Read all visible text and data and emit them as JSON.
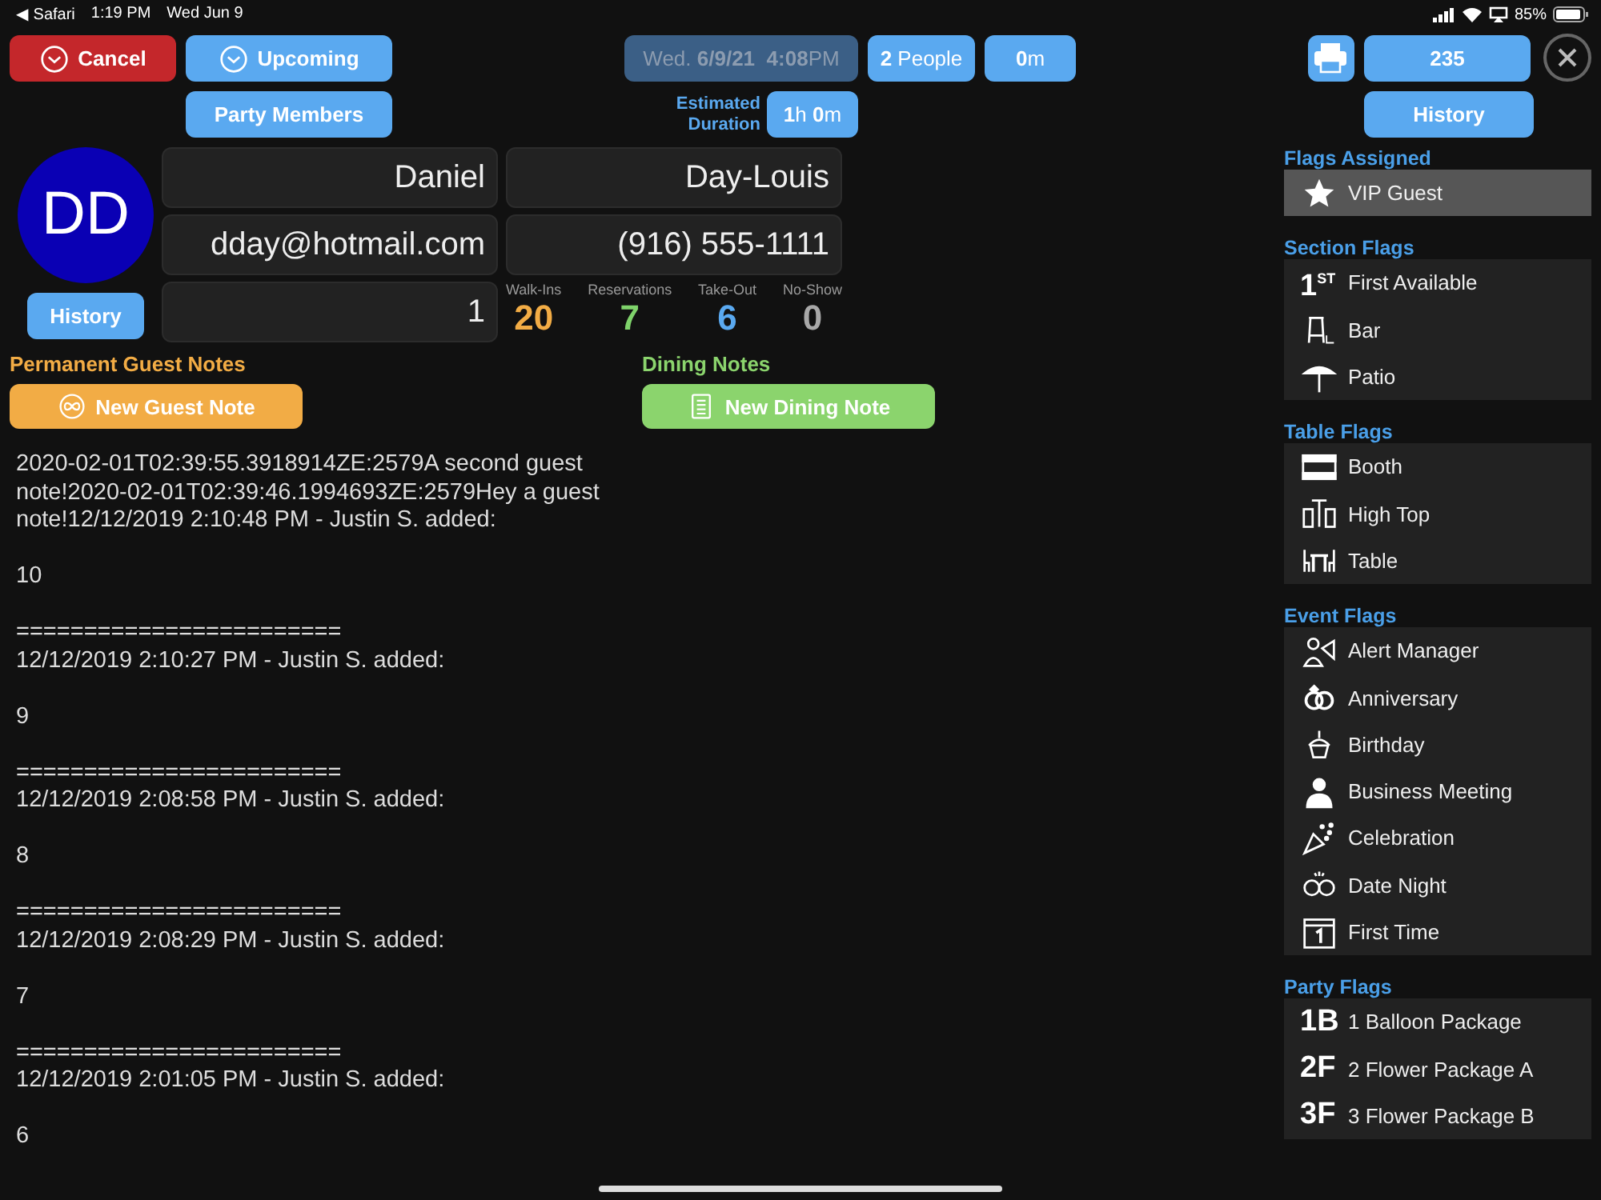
{
  "status_bar": {
    "back": "◀ Safari",
    "time": "1:19 PM",
    "date": "Wed Jun 9",
    "battery": "85%"
  },
  "toolbar": {
    "cancel": "Cancel",
    "upcoming": "Upcoming",
    "party_members": "Party Members",
    "datetime": "Wed. **6/9/21**  **4:08**PM",
    "people": "**2** People",
    "wait": "**0**m",
    "duration_label": "Estimated Duration",
    "duration": "**1**h **0**m"
  },
  "guest": {
    "initials": "DD",
    "history": "History",
    "first_name": "Daniel",
    "last_name": "Day-Louis",
    "email": "dday@hotmail.com",
    "phone": "(916) 555-1111",
    "field_5": "1"
  },
  "stats": [
    {
      "label": "Walk-Ins",
      "value": "20",
      "color": "#f2ac45"
    },
    {
      "label": "Reservations",
      "value": "7",
      "color": "#7fd36b"
    },
    {
      "label": "Take-Out",
      "value": "6",
      "color": "#5aa9f0"
    },
    {
      "label": "No-Show",
      "value": "0",
      "color": "#a8a8a8"
    }
  ],
  "permanent_notes": {
    "title": "Permanent Guest Notes",
    "button": "New Guest Note"
  },
  "dining_notes": {
    "title": "Dining Notes",
    "button": "New Dining Note"
  },
  "notes": [
    {
      "stamp": "2020-02-01T02:39:55.3918914ZE:2579A second guest note!2020-02-01T02:39:46.1994693ZE:2579Hey a guest note!12/12/2019 2:10:48 PM - Justin S. added:",
      "value": "10"
    },
    {
      "separator": "========================",
      "stamp": "12/12/2019 2:10:27 PM - Justin S. added:",
      "value": "9"
    },
    {
      "separator": "========================",
      "stamp": "12/12/2019 2:08:58 PM - Justin S. added:",
      "value": "8"
    },
    {
      "separator": "========================",
      "stamp": "12/12/2019 2:08:29 PM - Justin S. added:",
      "value": "7"
    },
    {
      "separator": "========================",
      "stamp": "12/12/2019 2:01:05 PM - Justin S. added:",
      "value": "6"
    }
  ],
  "right_panel": {
    "order_number": "235",
    "history": "History"
  },
  "flag_sections": [
    {
      "title": "Flags Assigned",
      "kind": "assigned",
      "items": [
        {
          "kind": "star",
          "label": "VIP Guest"
        }
      ]
    },
    {
      "title": "Section Flags",
      "kind": "available",
      "items": [
        {
          "kind": "ordinal",
          "code": "1$^{ST}$",
          "label": "First Available"
        },
        {
          "kind": "stool",
          "label": "Bar"
        },
        {
          "kind": "umbrella",
          "label": "Patio"
        }
      ]
    },
    {
      "title": "Table Flags",
      "kind": "available",
      "items": [
        {
          "kind": "booth",
          "label": "Booth"
        },
        {
          "kind": "high-top",
          "label": "High Top"
        },
        {
          "kind": "table",
          "label": "Table"
        }
      ]
    },
    {
      "title": "Event Flags",
      "kind": "available",
      "items": [
        {
          "kind": "manager",
          "label": "Alert Manager"
        },
        {
          "kind": "rings",
          "label": "Anniversary"
        },
        {
          "kind": "cupcake",
          "label": "Birthday"
        },
        {
          "kind": "person",
          "label": "Business Meeting"
        },
        {
          "kind": "confetti",
          "label": "Celebration"
        },
        {
          "kind": "faces",
          "label": "Date Night"
        },
        {
          "kind": "calendar",
          "label": "First Time"
        }
      ]
    },
    {
      "title": "Party Flags",
      "kind": "available",
      "items": [
        {
          "kind": "code",
          "code": "1B",
          "label": "1 Balloon Package"
        },
        {
          "kind": "code",
          "code": "2F",
          "label": "2 Flower Package A"
        },
        {
          "kind": "code",
          "code": "3F",
          "label": "3 Flower Package B"
        }
      ]
    }
  ]
}
